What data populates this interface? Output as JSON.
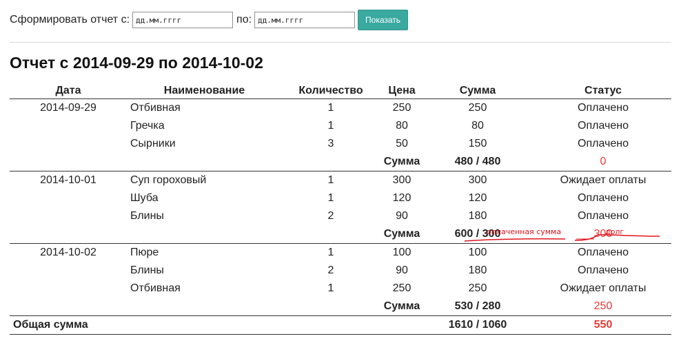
{
  "filter": {
    "from_label": "Сформировать отчет с:",
    "from_placeholder": "дд.мм.гггг",
    "to_label": "по:",
    "to_placeholder": "дд.мм.гггг",
    "show_button": "Показать"
  },
  "report": {
    "title": "Отчет с 2014-09-29 по 2014-10-02",
    "columns": [
      "Дата",
      "Наименование",
      "Количество",
      "Цена",
      "Сумма",
      "Статус"
    ],
    "groups": [
      {
        "date": "2014-09-29",
        "rows": [
          {
            "name": "Отбивная",
            "qty": "1",
            "price": "250",
            "sum": "250",
            "status": "Оплачено"
          },
          {
            "name": "Гречка",
            "qty": "1",
            "price": "80",
            "sum": "80",
            "status": "Оплачено"
          },
          {
            "name": "Сырники",
            "qty": "3",
            "price": "50",
            "sum": "150",
            "status": "Оплачено"
          }
        ],
        "subtotal_label": "Сумма",
        "subtotal": "480 / 480",
        "debt": "0"
      },
      {
        "date": "2014-10-01",
        "rows": [
          {
            "name": "Суп гороховый",
            "qty": "1",
            "price": "300",
            "sum": "300",
            "status": "Ожидает оплаты"
          },
          {
            "name": "Шуба",
            "qty": "1",
            "price": "120",
            "sum": "120",
            "status": "Оплачено"
          },
          {
            "name": "Блины",
            "qty": "2",
            "price": "90",
            "sum": "180",
            "status": "Оплачено"
          }
        ],
        "subtotal_label": "Сумма",
        "subtotal": "600 / 300",
        "debt": "300"
      },
      {
        "date": "2014-10-02",
        "rows": [
          {
            "name": "Пюре",
            "qty": "1",
            "price": "100",
            "sum": "100",
            "status": "Оплачено"
          },
          {
            "name": "Блины",
            "qty": "2",
            "price": "90",
            "sum": "180",
            "status": "Оплачено"
          },
          {
            "name": "Отбивная",
            "qty": "1",
            "price": "250",
            "sum": "250",
            "status": "Ожидает оплаты"
          }
        ],
        "subtotal_label": "Сумма",
        "subtotal": "530 / 280",
        "debt": "250"
      }
    ],
    "total_label": "Общая сумма",
    "total": "1610 / 1060",
    "total_debt": "550"
  },
  "annotations": {
    "paid_sum": "оплаченная сумма",
    "debt": "долг"
  },
  "colors": {
    "accent": "#3aa9a0",
    "debt": "#e53935",
    "annotation": "#e0141e"
  }
}
